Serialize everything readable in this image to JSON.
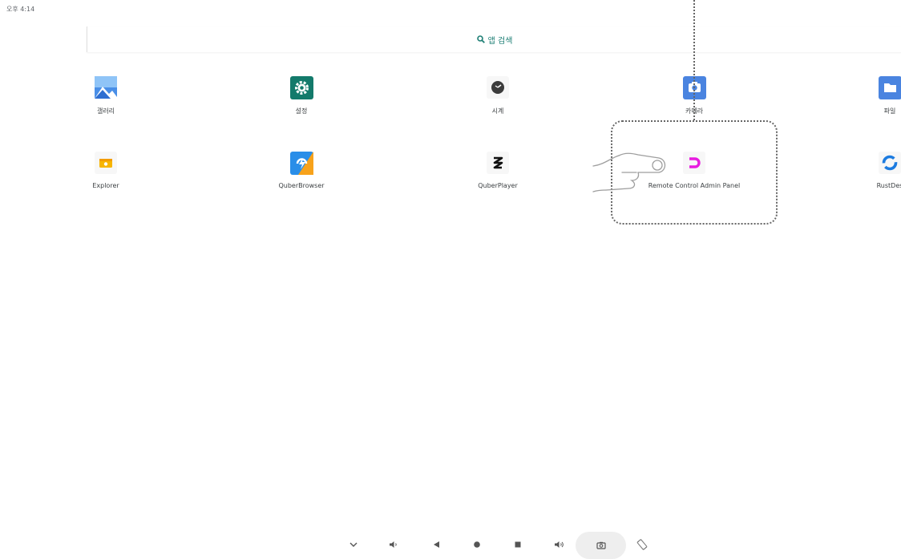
{
  "status_bar": {
    "time": "오후 4:14"
  },
  "search": {
    "label": "앱 검색"
  },
  "apps_row1": [
    {
      "label": "갤러리",
      "icon": "gallery-icon"
    },
    {
      "label": "설정",
      "icon": "settings-gear-icon"
    },
    {
      "label": "시계",
      "icon": "clock-icon"
    },
    {
      "label": "카메라",
      "icon": "camera-icon"
    },
    {
      "label": "파일",
      "icon": "folder-icon"
    }
  ],
  "apps_row2": [
    {
      "label": "Explorer",
      "icon": "explorer-icon"
    },
    {
      "label": "QuberBrowser",
      "icon": "quber-browser-icon"
    },
    {
      "label": "QuberPlayer",
      "icon": "quber-player-icon"
    },
    {
      "label": "Remote Control Admin Panel",
      "icon": "remote-control-icon"
    },
    {
      "label": "RustDes",
      "icon": "rustdesk-icon"
    }
  ],
  "colors": {
    "search_accent": "#1e7f75",
    "gallery_blue": "#4a8fe7",
    "settings_teal": "#137a6b",
    "camera_blue": "#4a84e0",
    "folder_blue": "#4a84e0",
    "remote_magenta": "#e81ce0",
    "rust_blue": "#1c7be0"
  },
  "nav_bar": {
    "buttons": [
      "chevron-down-icon",
      "volume-down-icon",
      "back-icon",
      "home-icon",
      "recents-icon",
      "volume-up-icon",
      "screenshot-icon",
      "rotate-icon"
    ]
  }
}
